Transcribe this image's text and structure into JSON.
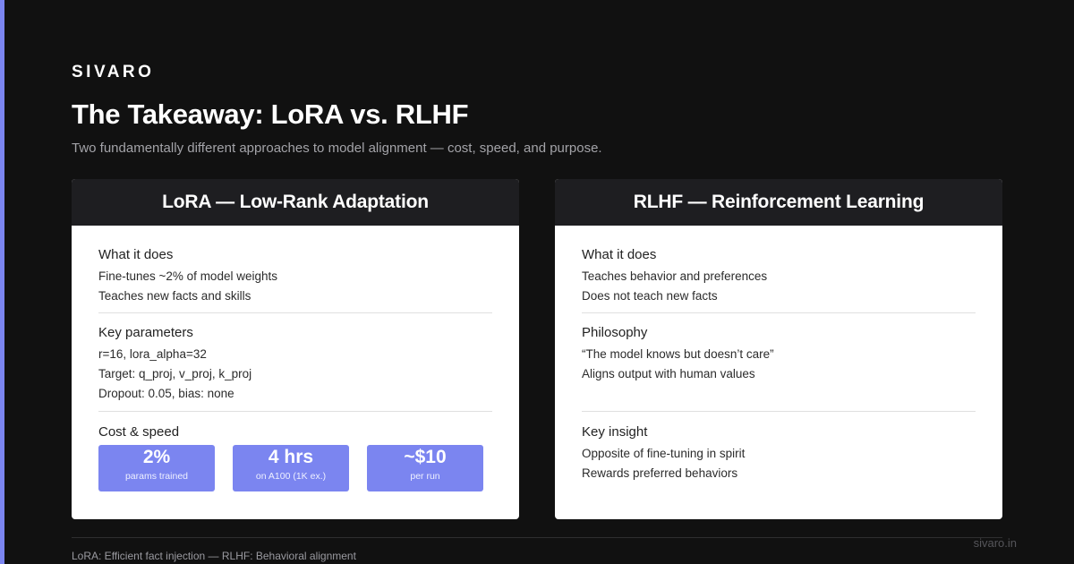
{
  "brand": "SIVARO",
  "title": "The Takeaway: LoRA vs. RLHF",
  "subtitle": "Two fundamentally different approaches to model alignment — cost, speed, and purpose.",
  "colors": {
    "background": "#111111",
    "accent": "#7b85f0",
    "card_header": "#1e1e21"
  },
  "left_card": {
    "header": "LoRA — Low-Rank Adaptation",
    "sections": [
      {
        "heading": "What it does",
        "lines": [
          "Fine-tunes ~2% of model weights",
          "Teaches new facts and skills"
        ]
      },
      {
        "heading": "Key parameters",
        "lines": [
          "r=16, lora_alpha=32",
          "Target: q_proj, v_proj, k_proj",
          "Dropout: 0.05, bias: none"
        ]
      },
      {
        "heading": "Cost & speed",
        "stats": [
          {
            "value": "2%",
            "label": "params trained"
          },
          {
            "value": "4 hrs",
            "label": "on A100 (1K ex.)"
          },
          {
            "value": "~$10",
            "label": "per run"
          }
        ]
      }
    ]
  },
  "right_card": {
    "header": "RLHF — Reinforcement Learning",
    "sections": [
      {
        "heading": "What it does",
        "lines": [
          "Teaches behavior and preferences",
          "Does not teach new facts"
        ]
      },
      {
        "heading": "Philosophy",
        "lines": [
          "“The model knows but doesn’t care”",
          "Aligns output with human values"
        ]
      },
      {
        "heading": "Key insight",
        "lines": [
          "Opposite of fine-tuning in spirit",
          "Rewards preferred behaviors"
        ]
      }
    ]
  },
  "footer": {
    "text": "LoRA: Efficient fact injection — RLHF: Behavioral alignment",
    "site": "sivaro.in"
  }
}
